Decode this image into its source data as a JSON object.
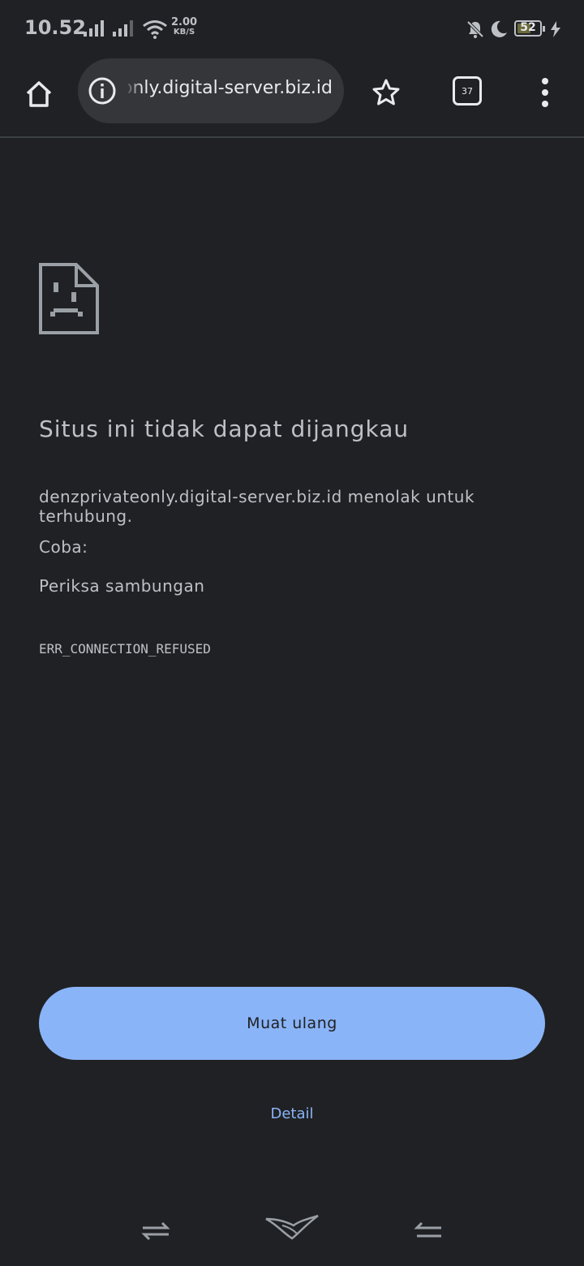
{
  "status_bar": {
    "time": "10.52",
    "net_speed_value": "2.00",
    "net_speed_unit": "KB/S",
    "battery_level": "52",
    "icons": [
      "signal-1-icon",
      "signal-2-icon",
      "wifi-icon",
      "mute-icon",
      "do-not-disturb-icon",
      "battery-icon",
      "charging-icon"
    ]
  },
  "toolbar": {
    "url": "denzprivateonly.digital-server.biz.id",
    "tab_count": "37",
    "icons": [
      "home-icon",
      "info-icon",
      "bookmark-star-icon",
      "tab-switcher-icon",
      "more-menu-icon"
    ]
  },
  "error_page": {
    "title": "Situs ini tidak dapat dijangkau",
    "message": "denzprivateonly.digital-server.biz.id menolak untuk terhubung.",
    "try_label": "Coba:",
    "suggestion": "Periksa sambungan",
    "error_code": "ERR_CONNECTION_REFUSED",
    "reload_label": "Muat ulang",
    "details_label": "Detail"
  },
  "colors": {
    "background": "#202124",
    "omnibox": "#35363a",
    "text": "#bdc1c6",
    "accent": "#8ab4f8"
  }
}
